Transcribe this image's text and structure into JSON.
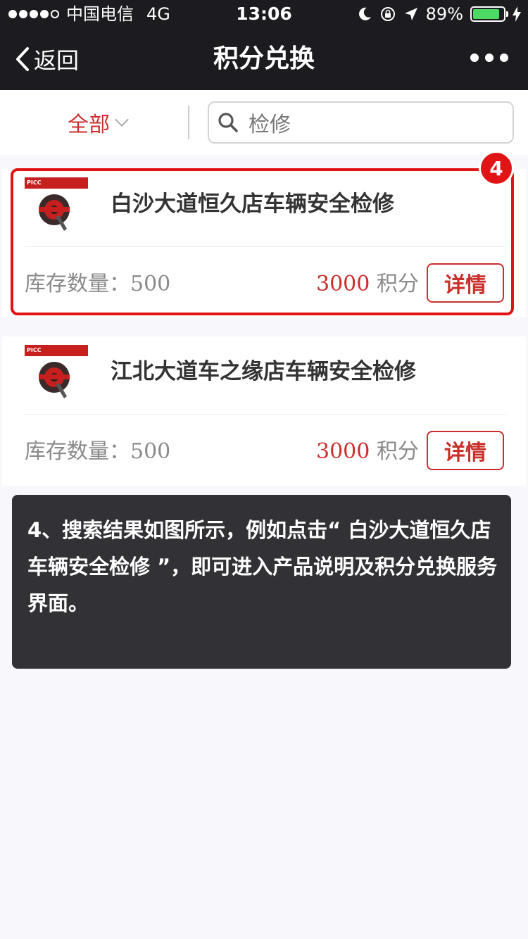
{
  "status_bar": {
    "carrier": "中国电信",
    "network": "4G",
    "time": "13:06",
    "battery": "89%",
    "battery_level": 0.89,
    "battery_color": "#4cd964"
  },
  "nav": {
    "back_label": "返回",
    "title": "积分兑换",
    "back_icon": "chevron-left-icon",
    "more_icon": "more-dots-icon"
  },
  "filter": {
    "category": "全部",
    "search_value": "检修",
    "search_icon": "search-icon"
  },
  "products": [
    {
      "name": "白沙大道恒久店车辆安全检修",
      "stock_label": "库存数量：",
      "stock": "500",
      "points": "3000",
      "points_unit": "积分",
      "detail_label": "详情",
      "brand": "PICC"
    },
    {
      "name": "江北大道车之缘店车辆安全检修",
      "stock_label": "库存数量：",
      "stock": "500",
      "points": "3000",
      "points_unit": "积分",
      "detail_label": "详情",
      "brand": "PICC"
    }
  ],
  "annotation": {
    "step": "4",
    "caption": "4、搜索结果如图所示，例如点击“ 白沙大道恒久店车辆安全检修 ”，即可进入产品说明及积分兑换服务界面。",
    "highlight_color": "#e01414"
  },
  "colors": {
    "accent": "#c9302c",
    "nav_bg": "#1c1b20",
    "caption_bg": "#323136"
  }
}
